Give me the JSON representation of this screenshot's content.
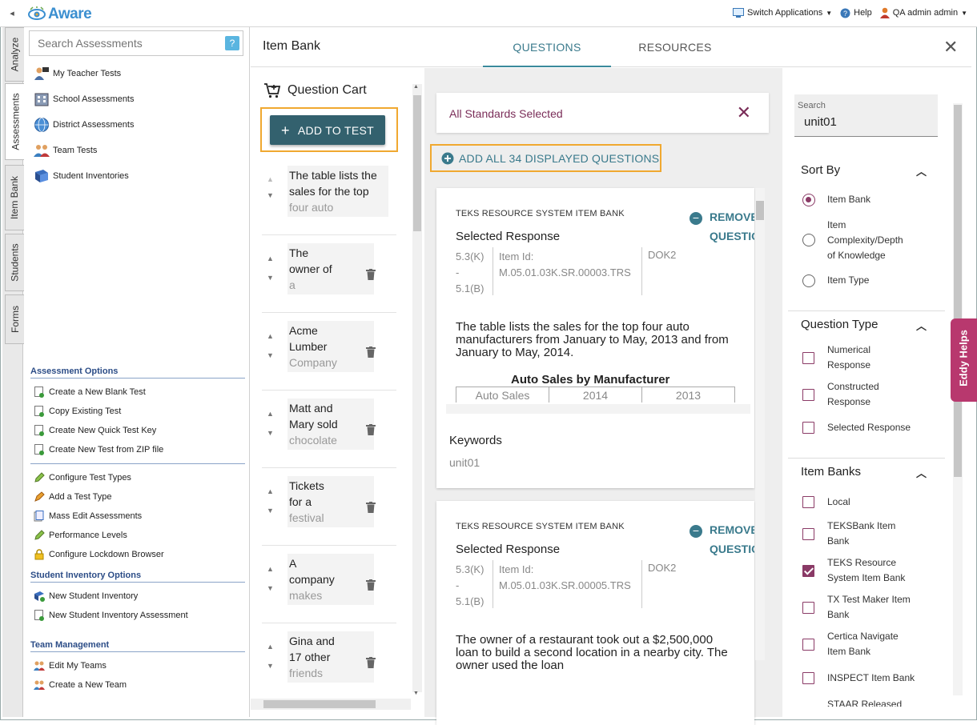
{
  "topbar": {
    "logo_text": "Aware",
    "switch_apps": "Switch Applications",
    "help": "Help",
    "user": "QA admin admin"
  },
  "side_tabs": [
    "Analyze",
    "Assessments",
    "Item Bank",
    "Students",
    "Forms"
  ],
  "left_panel": {
    "search_placeholder": "Search Assessments",
    "help_glyph": "?",
    "nav": [
      {
        "label": "My Teacher Tests",
        "icon": "teacher-tests-icon"
      },
      {
        "label": "School Assessments",
        "icon": "school-icon"
      },
      {
        "label": "District Assessments",
        "icon": "globe-icon"
      },
      {
        "label": "Team Tests",
        "icon": "team-icon"
      },
      {
        "label": "Student Inventories",
        "icon": "book-icon"
      }
    ],
    "assessment_options": {
      "heading": "Assessment Options",
      "items": [
        "Create a New Blank Test",
        "Copy Existing Test",
        "Create New Quick Test Key",
        "Create New Test from ZIP file"
      ],
      "items2": [
        "Configure Test Types",
        "Add a Test Type",
        "Mass Edit Assessments",
        "Performance Levels",
        "Configure Lockdown Browser"
      ]
    },
    "student_inventory_options": {
      "heading": "Student Inventory Options",
      "items": [
        "New Student Inventory",
        "New Student Inventory Assessment"
      ]
    },
    "team_management": {
      "heading": "Team Management",
      "items": [
        "Edit My Teams",
        "Create a New Team"
      ]
    }
  },
  "item_bank": {
    "title": "Item Bank",
    "tabs": [
      "QUESTIONS",
      "RESOURCES"
    ],
    "active_tab": "QUESTIONS"
  },
  "cart": {
    "heading": "Question Cart",
    "add_button": "ADD TO TEST",
    "items": [
      {
        "l1": "The table lists the",
        "l2": "sales for the top",
        "l3": "four auto"
      },
      {
        "l1": "The",
        "l2": "owner of",
        "l3": "a"
      },
      {
        "l1": "Acme",
        "l2": "Lumber",
        "l3": "Company"
      },
      {
        "l1": "Matt and",
        "l2": "Mary sold",
        "l3": "chocolate"
      },
      {
        "l1": "Tickets",
        "l2": "for a",
        "l3": "festival"
      },
      {
        "l1": "A",
        "l2": "company",
        "l3": "makes"
      },
      {
        "l1": "Gina and",
        "l2": "17 other",
        "l3": "friends"
      }
    ]
  },
  "questions": {
    "standards_filter": "All Standards Selected",
    "add_all": "ADD ALL 34 DISPLAYED QUESTIONS",
    "cards": [
      {
        "source": "TEKS RESOURCE SYSTEM ITEM BANK",
        "remove": "REMOVE\nQUESTION",
        "type": "Selected Response",
        "standards": [
          "5.3(K)",
          "-",
          "5.1(B)"
        ],
        "item_id_label": "Item Id:",
        "item_id": "M.05.01.03K.SR.00003.TRS",
        "dok": "DOK2",
        "stem": "The table lists the sales for the top four auto manufacturers from January to May, 2013 and from January to May, 2014.",
        "table_title": "Auto Sales by Manufacturer",
        "table_headers": [
          "Auto Sales",
          "2014",
          "2013"
        ],
        "keywords_label": "Keywords",
        "keywords": "unit01"
      },
      {
        "source": "TEKS RESOURCE SYSTEM ITEM BANK",
        "remove": "REMOVE\nQUESTION",
        "type": "Selected Response",
        "standards": [
          "5.3(K)",
          "-",
          "5.1(B)"
        ],
        "item_id_label": "Item Id:",
        "item_id": "M.05.01.03K.SR.00005.TRS",
        "dok": "DOK2",
        "stem": "The owner of a restaurant took out a $2,500,000 loan to build a second location in a nearby city. The owner used the loan"
      }
    ]
  },
  "filters": {
    "search_label": "Search",
    "search_value": "unit01",
    "sort_by": {
      "heading": "Sort By",
      "options": [
        "Item Bank",
        "Item Complexity/Depth of Knowledge",
        "Item Type"
      ],
      "selected": "Item Bank"
    },
    "question_type": {
      "heading": "Question Type",
      "options": [
        "Numerical Response",
        "Constructed Response",
        "Selected Response"
      ]
    },
    "item_banks": {
      "heading": "Item Banks",
      "options": [
        "Local",
        "TEKSBank Item Bank",
        "TEKS Resource System Item Bank",
        "TX Test Maker Item Bank",
        "Certica Navigate Item Bank",
        "INSPECT Item Bank",
        "STAAR Released"
      ],
      "checked": [
        "TEKS Resource System Item Bank"
      ]
    }
  },
  "eddy": "Eddy Helps",
  "colors": {
    "accent_teal": "#3a7a8c",
    "add_button_bg": "#33616e",
    "magenta": "#8a3a66",
    "highlight_orange": "#f0a830",
    "eddy_bg": "#b8386e"
  }
}
